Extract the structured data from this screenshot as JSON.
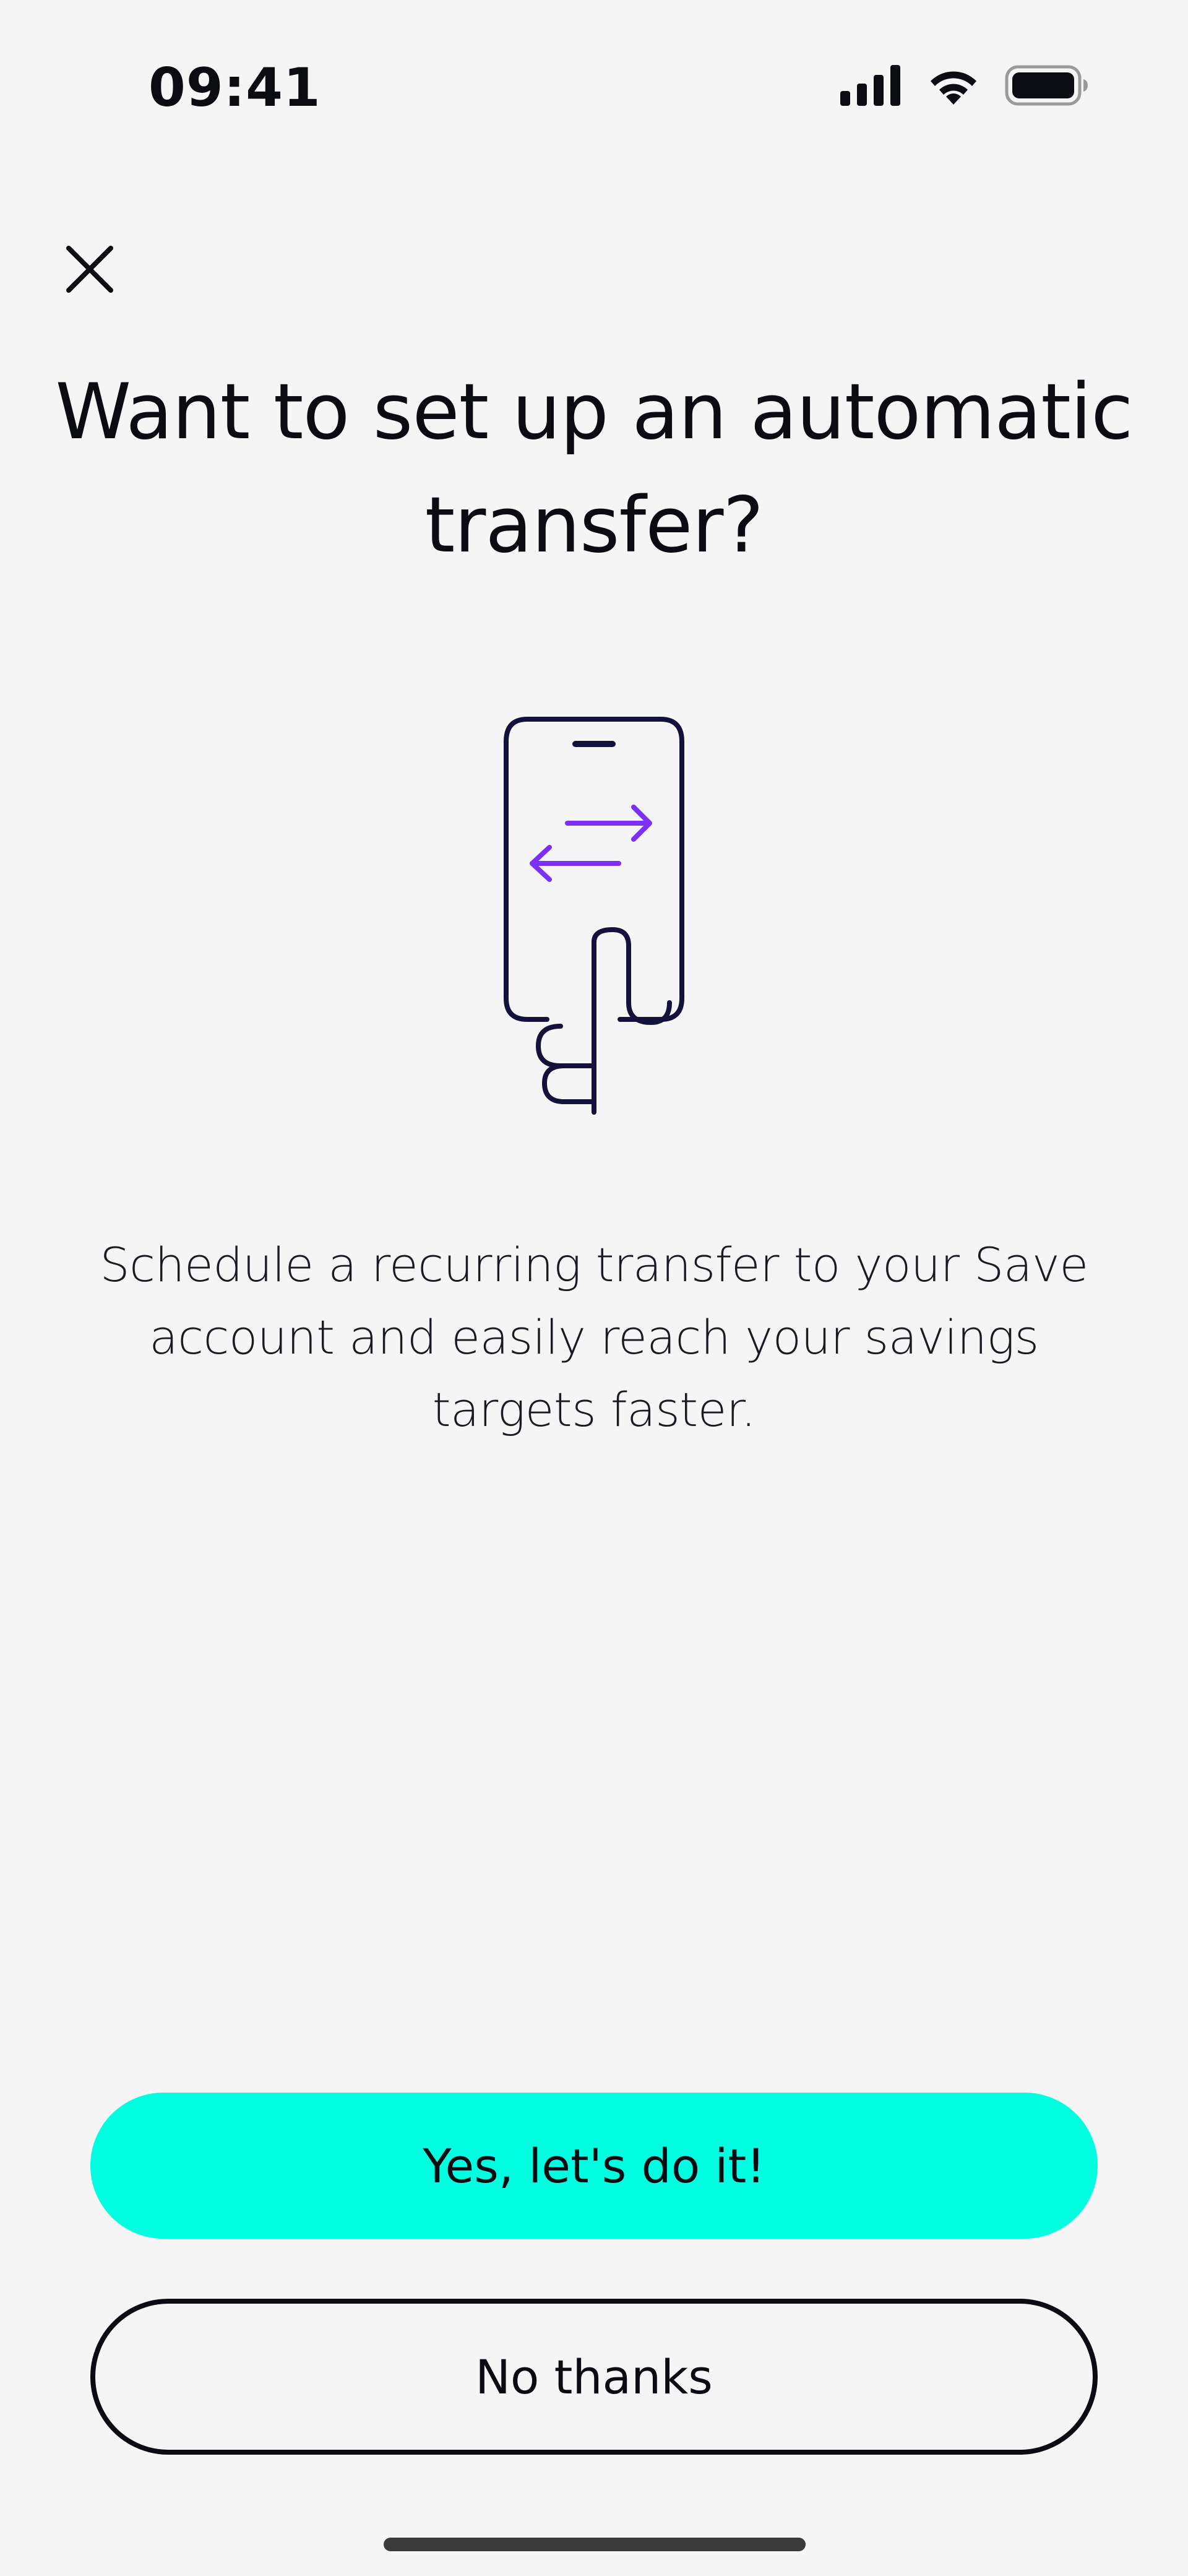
{
  "status_bar": {
    "time": "09:41",
    "icons": [
      "cellular-signal-icon",
      "wifi-icon",
      "battery-icon"
    ]
  },
  "close": {
    "icon": "close-icon"
  },
  "title": "Want to set up an automatic transfer?",
  "illustration": {
    "icon": "phone-transfer-icon",
    "accent_color": "#7b2ff7",
    "line_color": "#14113a"
  },
  "description": "Schedule a recurring transfer to your Save account and easily reach your savings targets faster.",
  "actions": {
    "primary_label": "Yes, let's do it!",
    "primary_color": "#00ffe0",
    "secondary_label": "No thanks"
  }
}
